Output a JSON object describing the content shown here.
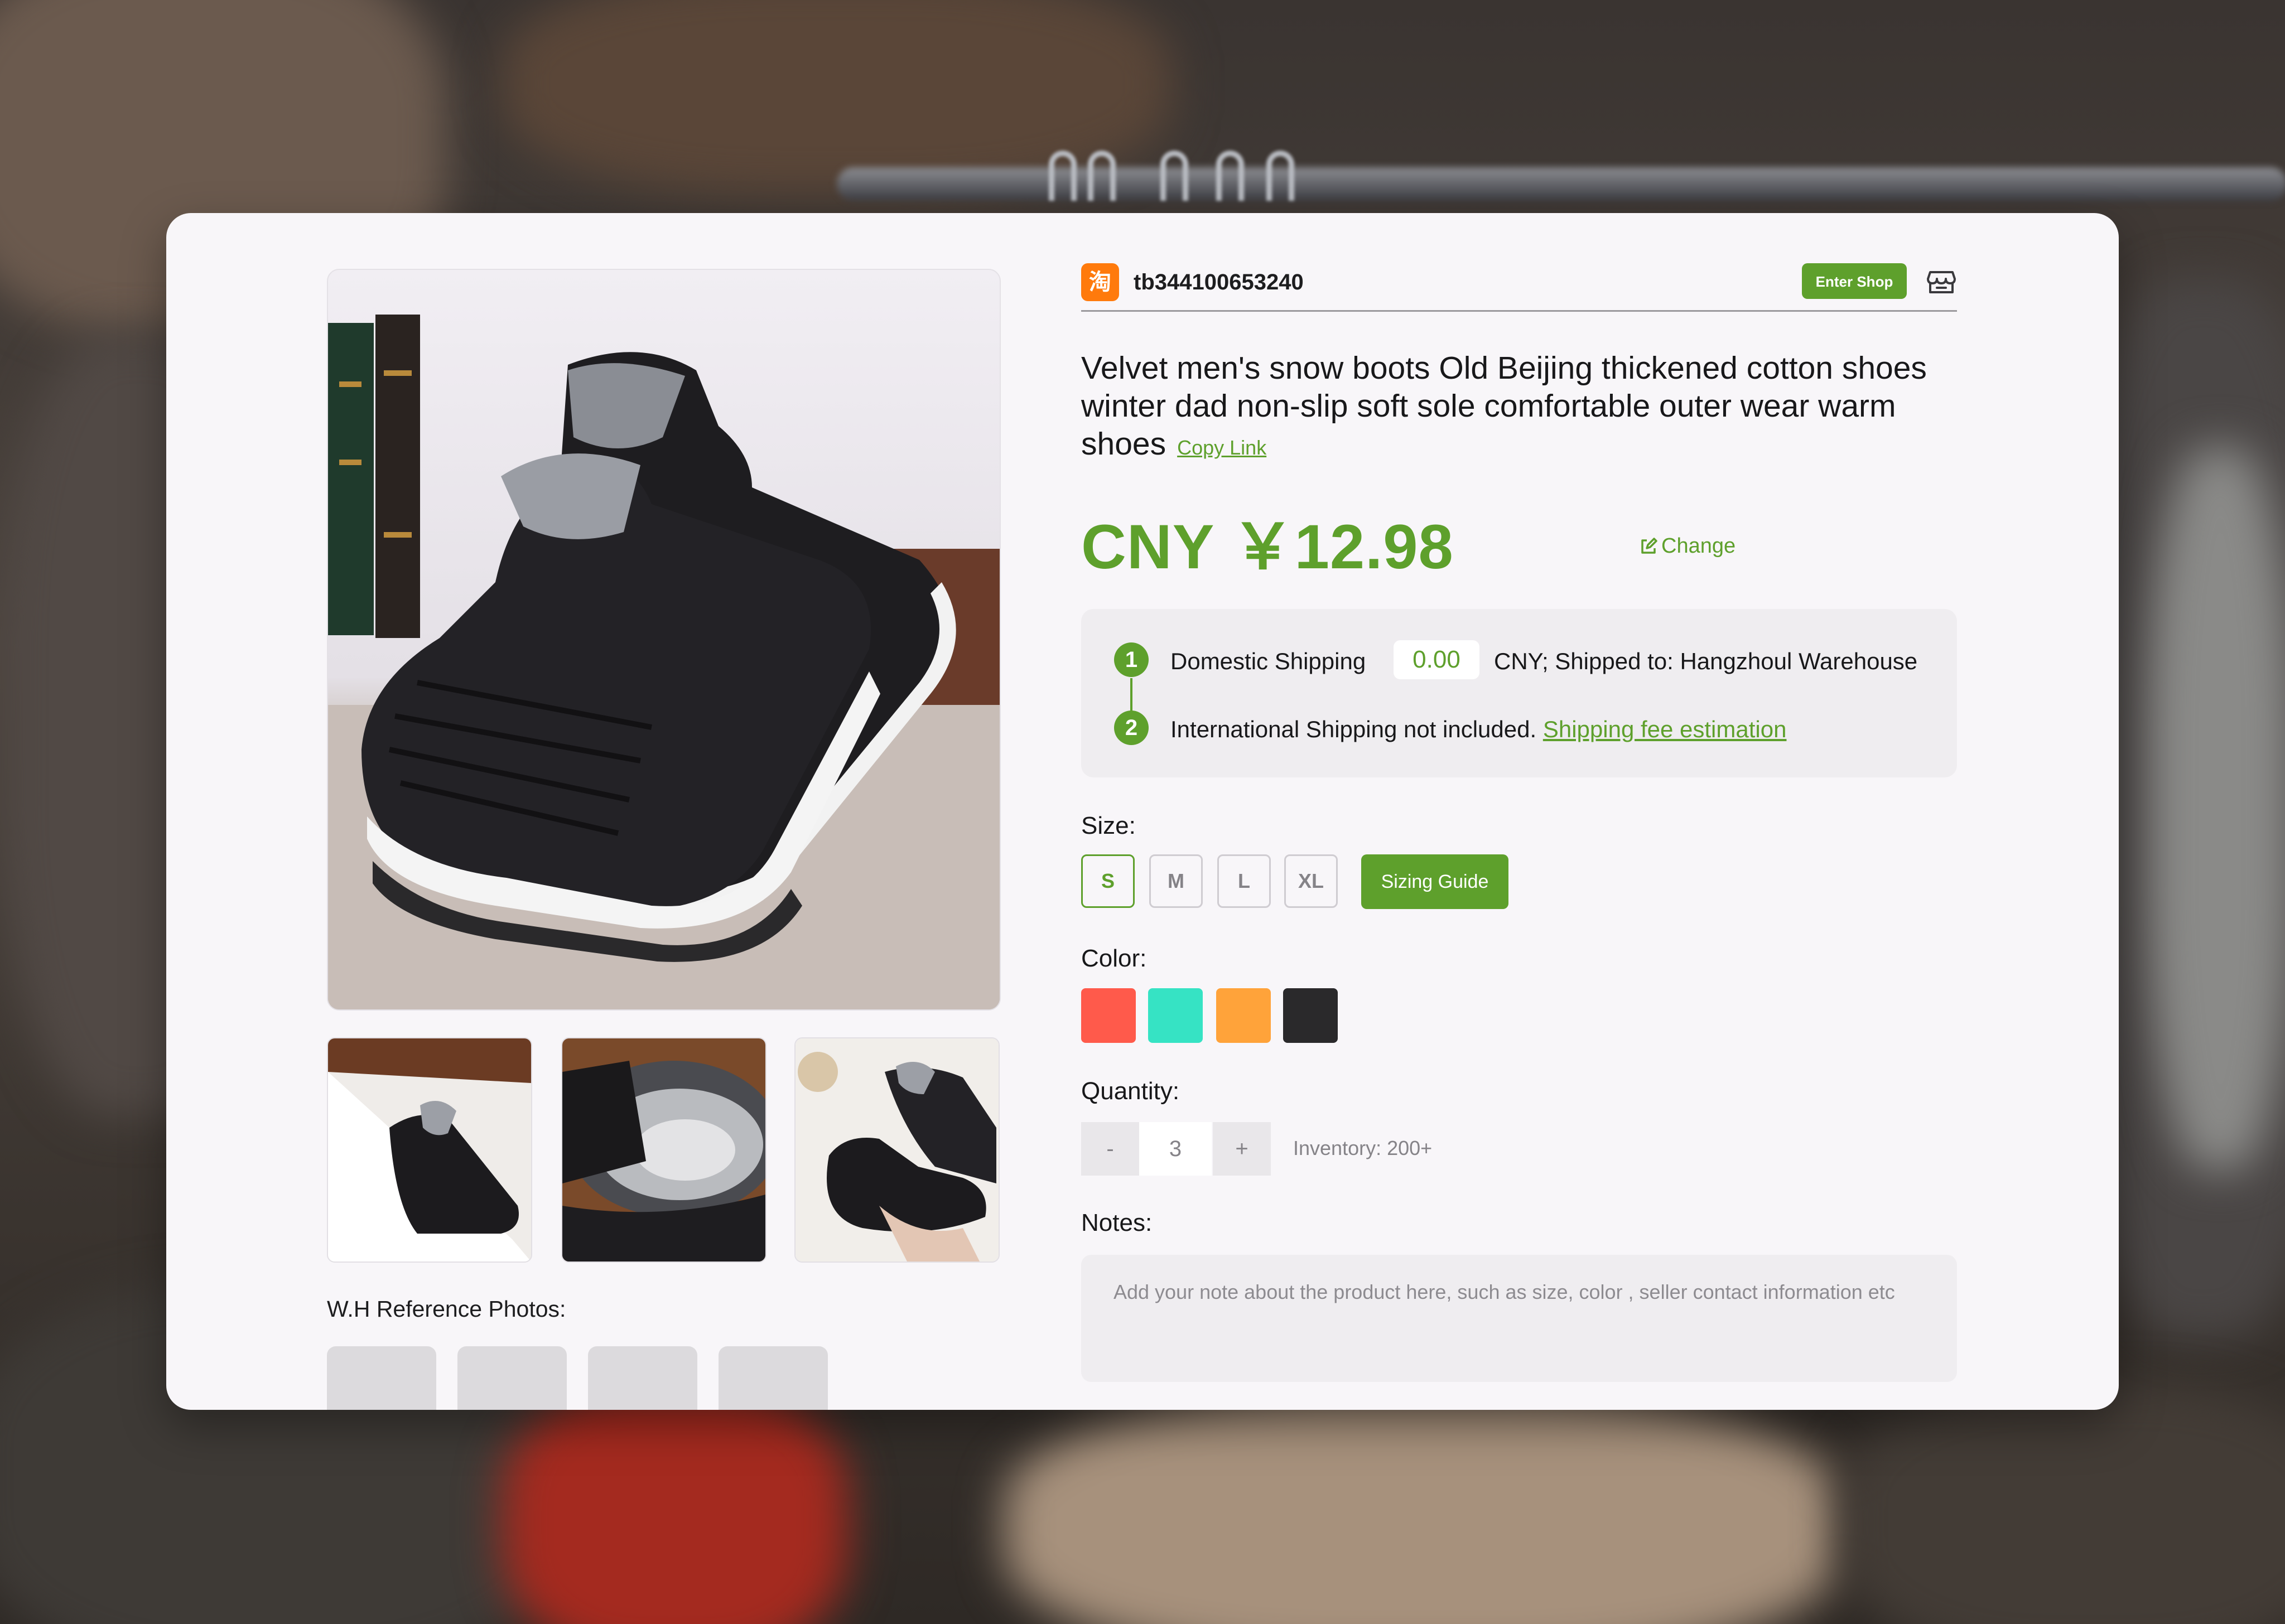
{
  "shop": {
    "logo_glyph": "淘",
    "id": "tb344100653240",
    "enter_label": "Enter Shop",
    "icon": "store-icon"
  },
  "product": {
    "title": "Velvet men's snow boots Old Beijing thickened cotton shoes winter dad non-slip soft sole comfortable outer wear warm shoes",
    "copy_link": "Copy Link",
    "price": "CNY ￥12.98",
    "change_label": "Change"
  },
  "shipping": {
    "step1": "1",
    "step2": "2",
    "domestic_label": "Domestic Shipping",
    "domestic_value": "0.00",
    "domestic_suffix": "CNY; Shipped to: Hangzhoul Warehouse",
    "intl_text": "International Shipping not included.",
    "estimate_link": "Shipping fee estimation"
  },
  "size": {
    "label": "Size:",
    "options": [
      "S",
      "M",
      "L",
      "XL"
    ],
    "selected": "S",
    "guide_label": "Sizing Guide"
  },
  "color": {
    "label": "Color:",
    "swatches": [
      "#ff5a4b",
      "#36e3c4",
      "#ffa33a",
      "#2a292b"
    ]
  },
  "quantity": {
    "label": "Quantity:",
    "minus": "-",
    "value": "3",
    "plus": "+",
    "inventory": "Inventory: 200+"
  },
  "notes": {
    "label": "Notes:",
    "placeholder": "Add your note about the product here, such as size, color , seller contact information etc"
  },
  "photos": {
    "ref_label": "W.H Reference Photos:"
  },
  "colors": {
    "accent": "#5ea02c",
    "card": "#f8f6f9",
    "panel": "#efedf0"
  }
}
